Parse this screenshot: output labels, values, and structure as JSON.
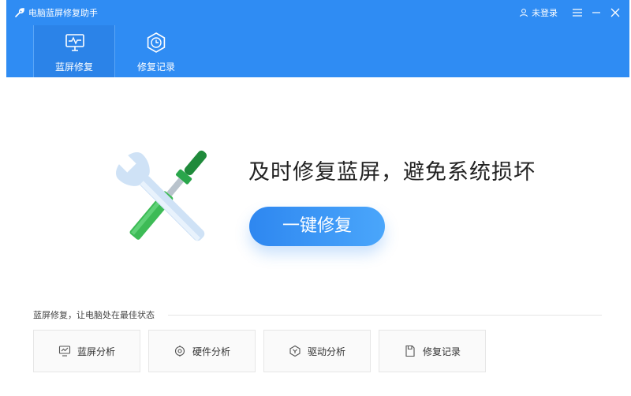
{
  "app": {
    "title": "电脑蓝屏修复助手"
  },
  "titlebar": {
    "login_label": "未登录"
  },
  "nav": {
    "tabs": [
      {
        "label": "蓝屏修复",
        "icon": "monitor-icon",
        "active": true
      },
      {
        "label": "修复记录",
        "icon": "clock-hexagon-icon",
        "active": false
      }
    ]
  },
  "hero": {
    "title": "及时修复蓝屏，避免系统损坏",
    "button_label": "一键修复"
  },
  "tools": {
    "section_label": "蓝屏修复，让电脑处在最佳状态",
    "items": [
      {
        "label": "蓝屏分析",
        "icon": "monitor-chart-icon"
      },
      {
        "label": "硬件分析",
        "icon": "hardware-icon"
      },
      {
        "label": "驱动分析",
        "icon": "driver-icon"
      },
      {
        "label": "修复记录",
        "icon": "record-icon"
      }
    ]
  },
  "colors": {
    "primary": "#2f8cf3",
    "accent_green": "#3dbb56"
  }
}
